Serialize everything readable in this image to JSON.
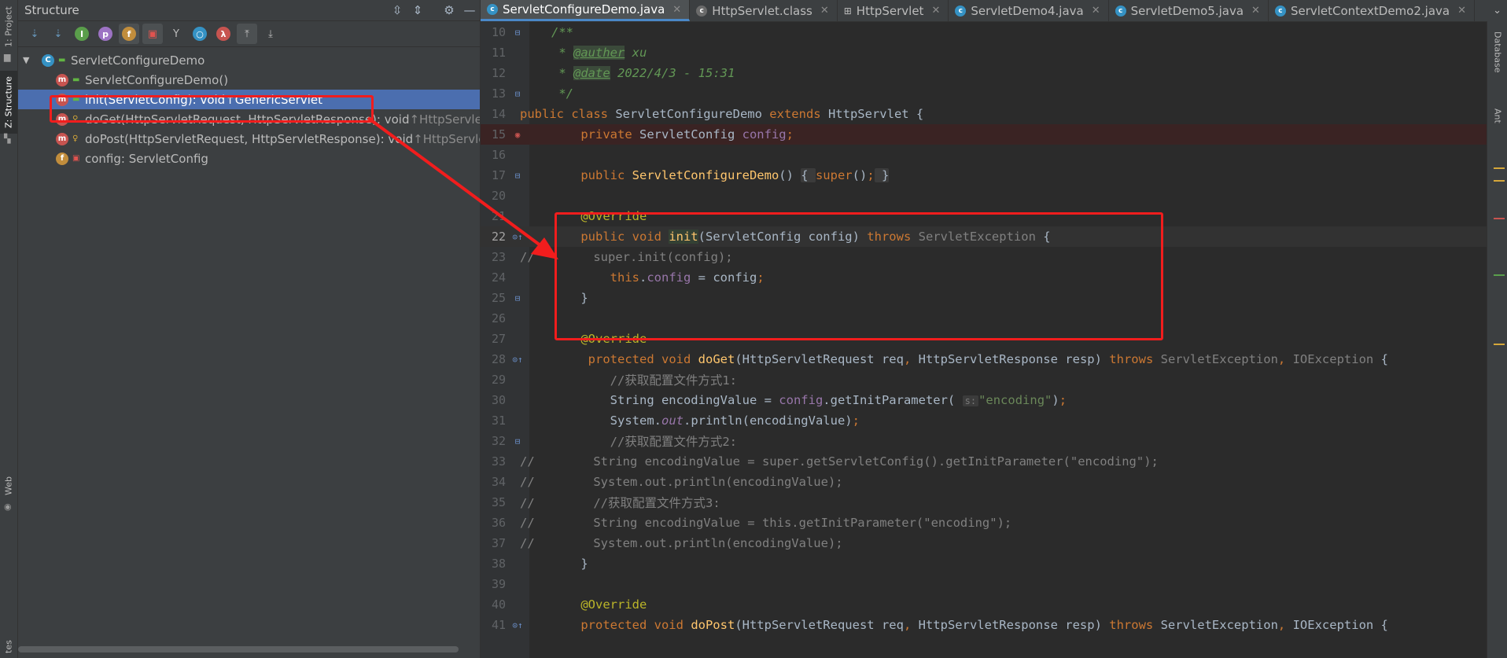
{
  "left_stripe": {
    "project_tab": "1: Project",
    "structure_tab": "Z: Structure",
    "web_tab": "Web",
    "bottom_tab": "tes"
  },
  "structure_pane": {
    "title": "Structure",
    "toolbar_icons": [
      "sort-by-type-icon",
      "sort-alphabetically-icon",
      "show-inherited-icon",
      "show-properties-icon",
      "show-fields-icon",
      "show-non-public-icon",
      "show-lambdas-icon",
      "anonymous-classes-icon",
      "lambda-icon",
      "autoscroll-to-source-icon",
      "autoscroll-from-source-icon"
    ],
    "tree": {
      "class_name": "ServletConfigureDemo",
      "members": [
        {
          "kind": "m",
          "text": "ServletConfigureDemo()",
          "suffix": "",
          "vis": "pub"
        },
        {
          "kind": "m",
          "text": "init(ServletConfig): void ",
          "suffix": "↑GenericServlet",
          "vis": "pub"
        },
        {
          "kind": "m",
          "text": "doGet(HttpServletRequest, HttpServletResponse): void ",
          "suffix": "↑HttpServlet",
          "vis": "prot"
        },
        {
          "kind": "m",
          "text": "doPost(HttpServletRequest, HttpServletResponse): void ",
          "suffix": "↑HttpServlet",
          "vis": "prot"
        },
        {
          "kind": "f",
          "text": "config: ServletConfig",
          "suffix": "",
          "vis": "priv"
        }
      ]
    }
  },
  "tabs": [
    {
      "label": "ServletConfigureDemo.java",
      "active": true,
      "closable": true
    },
    {
      "label": "HttpServlet.class",
      "active": false,
      "closable": true
    },
    {
      "label": "HttpServlet",
      "active": false,
      "closable": true
    },
    {
      "label": "ServletDemo4.java",
      "active": false,
      "closable": true
    },
    {
      "label": "ServletDemo5.java",
      "active": false,
      "closable": true
    },
    {
      "label": "ServletContextDemo2.java",
      "active": false,
      "closable": true
    }
  ],
  "editor": {
    "line_numbers": [
      "10",
      "11",
      "12",
      "13",
      "14",
      "15",
      "16",
      "17",
      "20",
      "21",
      "22",
      "23",
      "24",
      "25",
      "26",
      "27",
      "28",
      "29",
      "30",
      "31",
      "32",
      "33",
      "34",
      "35",
      "36",
      "37",
      "38",
      "39",
      "40",
      "41"
    ],
    "javadoc": {
      "open": "/**",
      "author_tag": "@auther",
      "author_value": " xu",
      "date_tag": "@date",
      "date_value": " 2022/4/3 - 15:31",
      "close": " */"
    },
    "hint_s": "s:",
    "string_encoding": "\"encoding\"",
    "comment_method1": "//获取配置文件方式1:",
    "comment_method2": "//获取配置文件方式2:",
    "comment_method3": "//获取配置文件方式3:",
    "commented_line_33": "        String encodingValue = super.getServletConfig().getInitParameter(\"encoding\");",
    "commented_line_34": "        System.out.println(encodingValue);",
    "commented_line_35": "        //获取配置文件方式3:",
    "commented_line_36": "        String encodingValue = this.getInitParameter(\"encoding\");",
    "commented_line_37": "        System.out.println(encodingValue);",
    "commented_line_23": "        super.init(config);"
  },
  "right_stripe": {
    "database_tab": "Database",
    "ant_tab": "Ant"
  },
  "colors": {
    "accent": "#4b6eaf",
    "highlight_box": "#f11d1d",
    "keyword": "#cc7832",
    "annotation": "#bbb529",
    "method": "#ffc66d",
    "field": "#9876aa",
    "string": "#6a8759"
  }
}
